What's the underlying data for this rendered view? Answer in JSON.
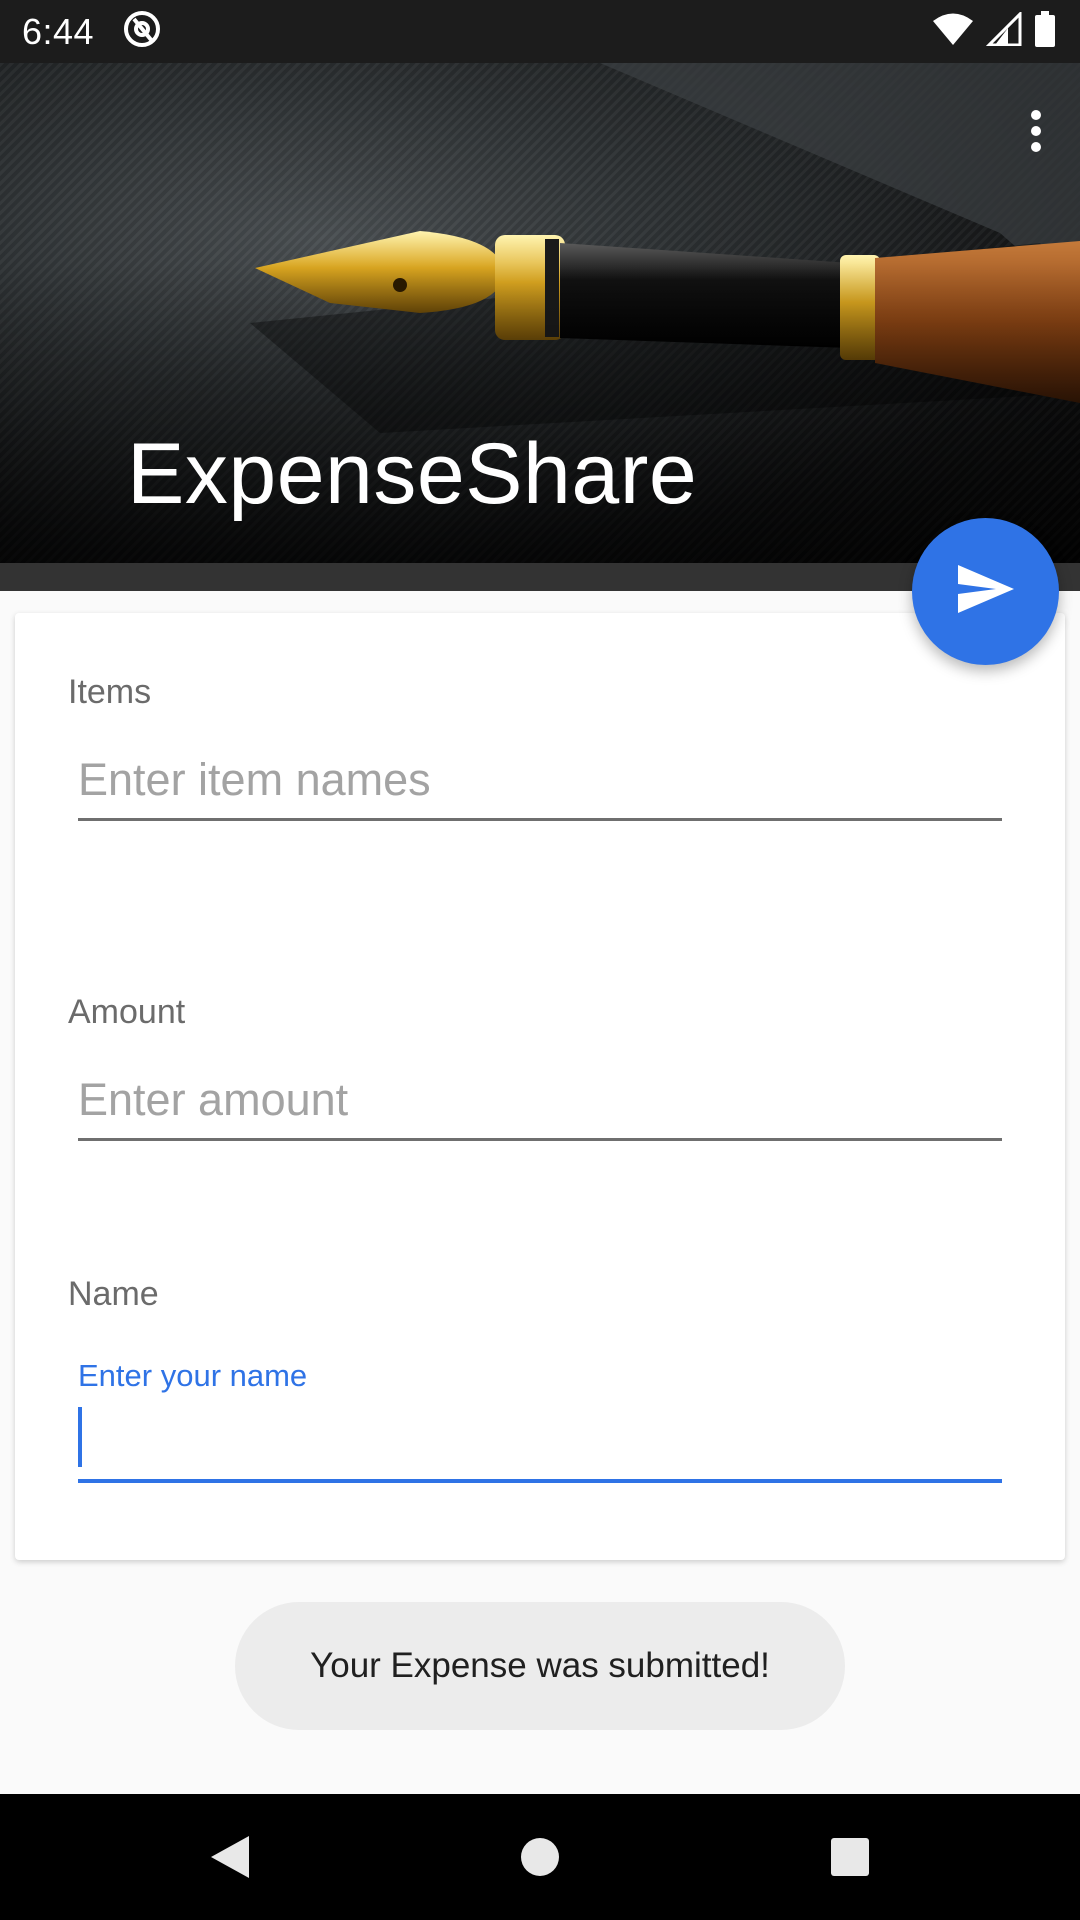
{
  "status_bar": {
    "time": "6:44",
    "icons": [
      "at-sign-icon",
      "wifi-icon",
      "cellular-signal-icon",
      "battery-icon"
    ]
  },
  "header": {
    "app_title": "ExpenseShare",
    "menu_icon": "more-vert-icon",
    "background_image": "fountain-pen-on-dark-paper"
  },
  "fab": {
    "icon": "send-icon",
    "color": "#2f73e6"
  },
  "form": {
    "items": {
      "label": "Items",
      "placeholder": "Enter item names",
      "value": ""
    },
    "amount": {
      "label": "Amount",
      "placeholder": "Enter amount",
      "value": ""
    },
    "name": {
      "label": "Name",
      "floating_hint": "Enter your name",
      "value": ""
    }
  },
  "toast": {
    "message": "Your Expense was submitted!"
  },
  "nav_bar": {
    "buttons": [
      "back-icon",
      "home-icon",
      "recents-icon"
    ]
  },
  "colors": {
    "accent": "#2f73e6",
    "status_bar": "#1c1c1c",
    "nav_bar": "#000000"
  }
}
